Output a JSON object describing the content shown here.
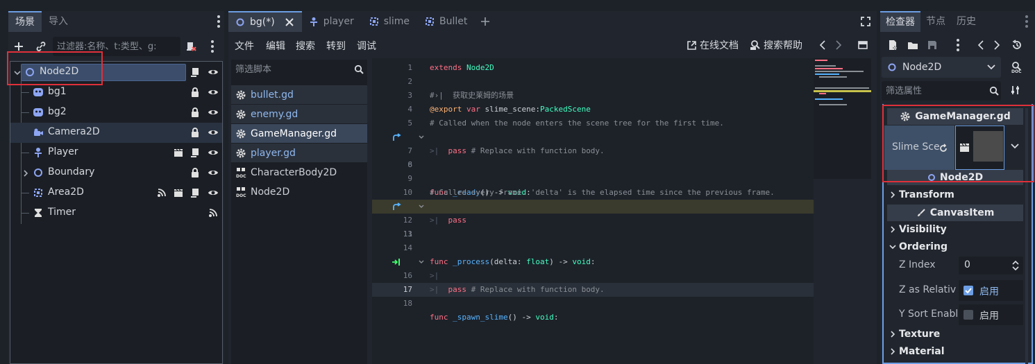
{
  "scene_dock": {
    "tabs": [
      {
        "label": "场景"
      },
      {
        "label": "导入"
      }
    ],
    "filter_placeholder": "过滤器:名称、t:类型、g:",
    "tree": [
      {
        "label": "Node2D"
      },
      {
        "label": "bg1"
      },
      {
        "label": "bg2"
      },
      {
        "label": "Camera2D"
      },
      {
        "label": "Player"
      },
      {
        "label": "Boundary"
      },
      {
        "label": "Area2D"
      },
      {
        "label": "Timer"
      }
    ]
  },
  "editor": {
    "tabs": [
      {
        "label": "bg(*)"
      },
      {
        "label": "player"
      },
      {
        "label": "slime"
      },
      {
        "label": "Bullet"
      }
    ],
    "menus": [
      {
        "label": "文件"
      },
      {
        "label": "编辑"
      },
      {
        "label": "搜索"
      },
      {
        "label": "转到"
      },
      {
        "label": "调试"
      }
    ],
    "online_docs": "在线文档",
    "search_help": "搜索帮助",
    "script_filter_placeholder": "筛选脚本",
    "scripts": [
      {
        "label": "bullet.gd"
      },
      {
        "label": "enemy.gd"
      },
      {
        "label": "GameManager.gd"
      },
      {
        "label": "player.gd"
      },
      {
        "label": "CharacterBody2D"
      },
      {
        "label": "Node2D"
      }
    ],
    "code": {
      "l1_a": "extends",
      "l1_b": "Node2D",
      "l3": "#›|  获取史莱姆的场景",
      "l4_a": "@export",
      "l4_b": "var",
      "l4_c": "slime_scene:",
      "l4_d": "PackedScene",
      "l5": "# Called when the node enters the scene tree for the first time.",
      "l6_a": "func",
      "l6_b": "_ready",
      "l6_c": "() ->",
      "l6_d": "void",
      "l7_a": "pass",
      "l7_b": "# Replace with function body.",
      "l10": "# Called every frame. 'delta' is the elapsed time since the previous frame.",
      "l11_a": "func",
      "l11_b": "_process",
      "l11_c": "(delta:",
      "l11_d": "float",
      "l11_e": ") ->",
      "l11_f": "void",
      "l12": "pass",
      "l15_a": "func",
      "l15_b": "_spawn_slime",
      "l15_c": "() ->",
      "l15_d": "void",
      "l17_a": "pass",
      "l17_b": "# Replace with function body.",
      "line_numbers": [
        "1",
        "2",
        "3",
        "4",
        "5",
        "6",
        "7",
        "8",
        "9",
        "10",
        "11",
        "12",
        "13",
        "14",
        "15",
        "16",
        "17",
        "18"
      ]
    }
  },
  "inspector": {
    "tabs": [
      {
        "label": "检查器"
      },
      {
        "label": "节点"
      },
      {
        "label": "历史"
      }
    ],
    "node_select": "Node2D",
    "filter_placeholder": "筛选属性",
    "script_section": "GameManager.gd",
    "slime_scene_label": "Slime Sce",
    "node2d_section": "Node2D",
    "transform": "Transform",
    "canvas_item": "CanvasItem",
    "visibility": "Visibility",
    "ordering": "Ordering",
    "z_index_label": "Z Index",
    "z_index_value": "0",
    "z_relative_label": "Z as Relativ",
    "z_relative_value": "启用",
    "y_sort_label": "Y Sort Enabl",
    "y_sort_value": "启用",
    "texture": "Texture",
    "material": "Material"
  },
  "colors": {
    "accent": "#6d9ee4",
    "highlight_red": "#e0303a",
    "keyword": "#ff7085",
    "type": "#42ffc2",
    "function": "#57b3ff"
  }
}
